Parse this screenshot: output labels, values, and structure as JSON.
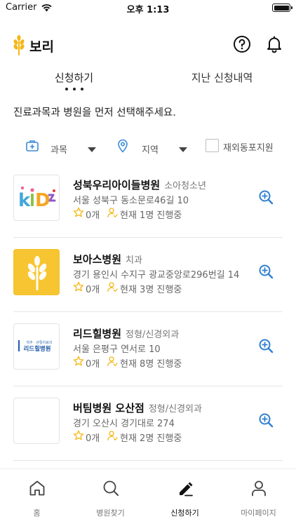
{
  "status_bar": {
    "carrier": "Carrier",
    "time": "오후 1:13"
  },
  "header": {
    "title": "보리",
    "brand_color": "#f5b716"
  },
  "tabs": [
    {
      "label": "신청하기",
      "active": true
    },
    {
      "label": "지난 신청내역",
      "active": false
    }
  ],
  "instruction": "진료과목과 병원을 먼저 선택해주세요.",
  "filters": {
    "subject_label": "과목",
    "region_label": "지역",
    "overseas_label": "재외동포지원",
    "overseas_checked": false,
    "icon_color": "#3a8bd8"
  },
  "hospitals": [
    {
      "name": "성북우리아이들병원",
      "category": "소아청소년",
      "address": "서울 성북구 동소문로46길 10",
      "stars": "0개",
      "waiting": "현재 1명 진행중",
      "thumb": "kids-logo"
    },
    {
      "name": "보아스병원",
      "category": "치과",
      "address": "경기 용인시 수지구 광교중앙로296번길 14",
      "stars": "0개",
      "waiting": "현재 3명 진행중",
      "thumb": "wheat-logo"
    },
    {
      "name": "리드힐병원",
      "category": "정형/신경외과",
      "address": "서울 은평구 연서로 10",
      "stars": "0개",
      "waiting": "현재 8명 진행중",
      "thumb": "readhill-logo",
      "thumb_top_text": "척추 · 관절치료의",
      "thumb_main_text": "리드힐병원"
    },
    {
      "name": "버팀병원 오산점",
      "category": "정형/신경외과",
      "address": "경기 오산시 경기대로 274",
      "stars": "0개",
      "waiting": "현재 2명 진행중",
      "thumb": "blank"
    }
  ],
  "bottom_nav": [
    {
      "label": "홈",
      "icon": "home-icon",
      "active": false
    },
    {
      "label": "병원찾기",
      "icon": "search-icon",
      "active": false
    },
    {
      "label": "신청하기",
      "icon": "edit-icon",
      "active": true
    },
    {
      "label": "마이페이지",
      "icon": "person-icon",
      "active": false
    }
  ]
}
